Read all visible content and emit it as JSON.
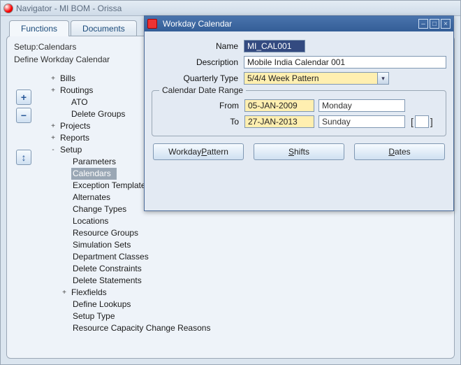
{
  "outer_window": {
    "title": "Navigator - MI BOM - Orissa"
  },
  "tabs": {
    "functions": "Functions",
    "documents": "Documents"
  },
  "breadcrumb": {
    "line1": "Setup:Calendars",
    "line2": "Define Workday Calendar"
  },
  "side_buttons": {
    "plus": "+",
    "minus": "−",
    "arrow": "↕"
  },
  "tree": {
    "bills": "Bills",
    "routings": "Routings",
    "ato": "ATO",
    "delete_groups": "Delete Groups",
    "projects": "Projects",
    "reports": "Reports",
    "setup": "Setup",
    "parameters": "Parameters",
    "calendars": "Calendars",
    "exception_templates": "Exception Templates",
    "alternates": "Alternates",
    "change_types": "Change Types",
    "locations": "Locations",
    "resource_groups": "Resource Groups",
    "simulation_sets": "Simulation Sets",
    "department_classes": "Department Classes",
    "delete_constraints": "Delete Constraints",
    "delete_statements": "Delete Statements",
    "flexfields": "Flexfields",
    "define_lookups": "Define Lookups",
    "setup_type": "Setup Type",
    "resource_capacity": "Resource Capacity Change Reasons"
  },
  "dialog": {
    "title": "Workday Calendar",
    "labels": {
      "name": "Name",
      "description": "Description",
      "quarterly_type": "Quarterly Type",
      "range_legend": "Calendar Date Range",
      "from": "From",
      "to": "To"
    },
    "values": {
      "name": "MI_CAL001",
      "description": "Mobile India Calendar 001",
      "quarterly_type": "5/4/4 Week Pattern",
      "from": "05-JAN-2009",
      "from_dow": "Monday",
      "to": "27-JAN-2013",
      "to_dow": "Sunday"
    },
    "buttons": {
      "workday_pattern_pre": "Workday ",
      "workday_pattern_ul": "P",
      "workday_pattern_post": "attern",
      "shifts_ul": "S",
      "shifts_post": "hifts",
      "dates_ul": "D",
      "dates_post": "ates"
    }
  }
}
